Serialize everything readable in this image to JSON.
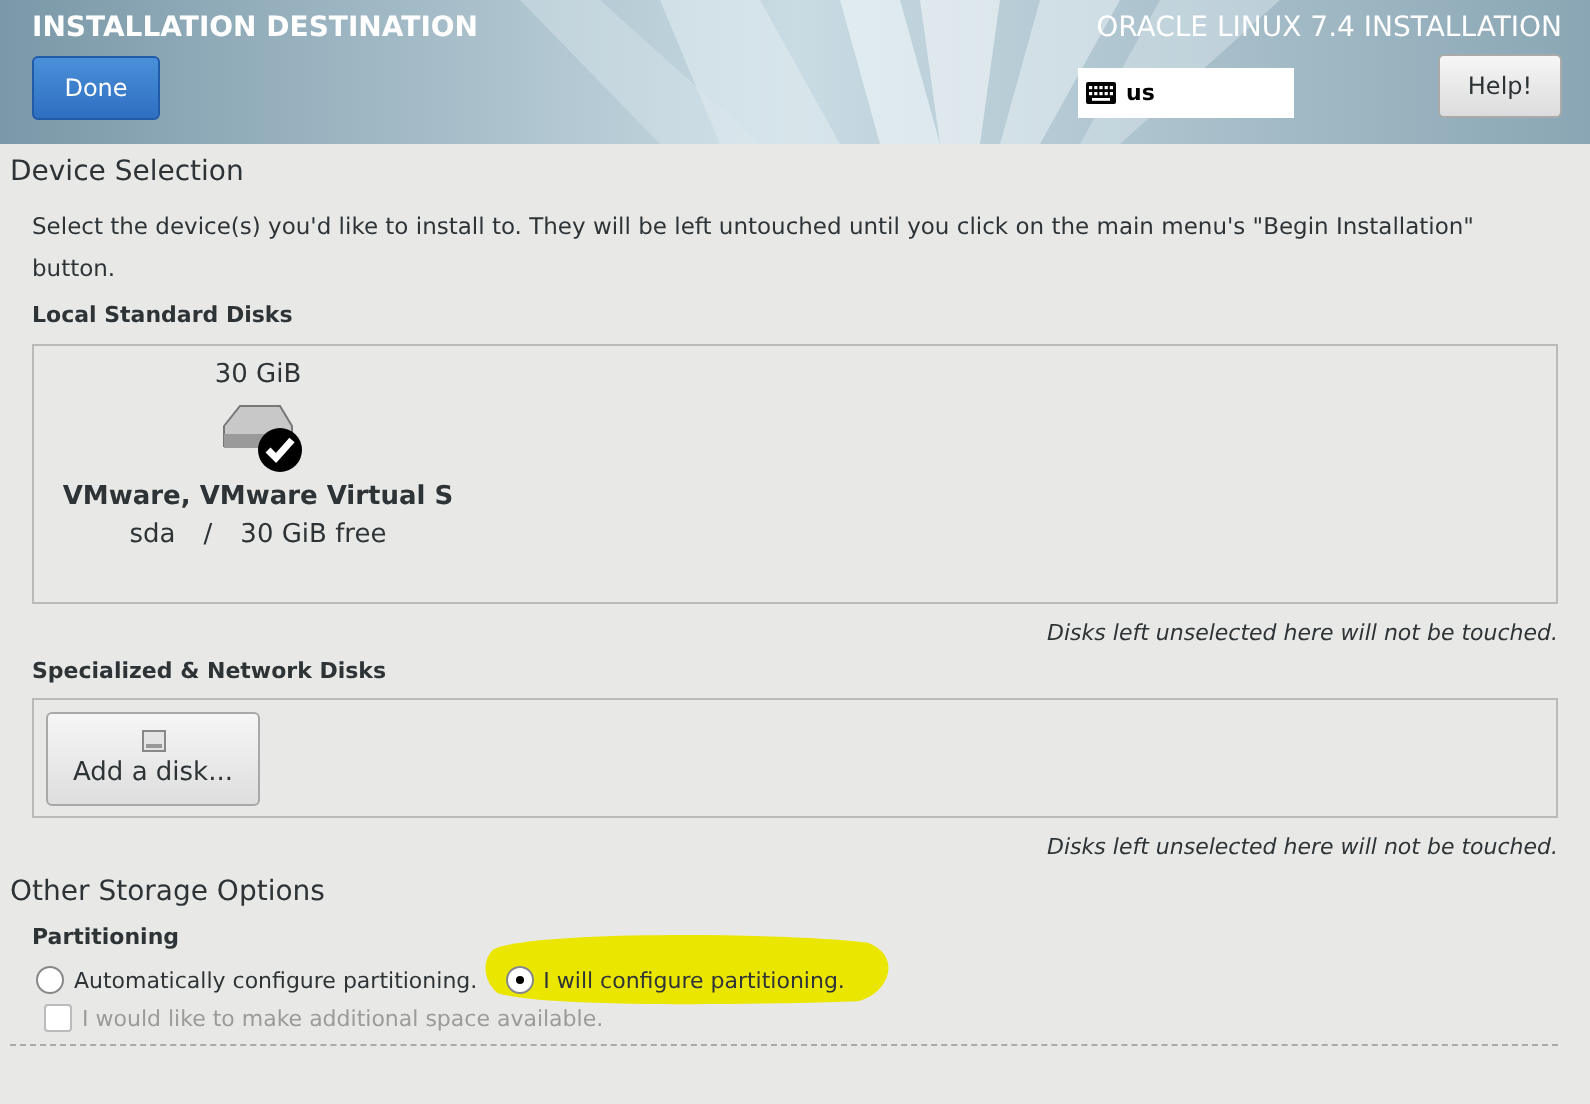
{
  "header": {
    "title": "INSTALLATION DESTINATION",
    "product": "ORACLE LINUX 7.4 INSTALLATION",
    "done_button": "Done",
    "keyboard_layout": "us",
    "help_button": "Help!"
  },
  "device_selection": {
    "heading": "Device Selection",
    "intro": "Select the device(s) you'd like to install to.  They will be left untouched until you click on the main menu's \"Begin Installation\" button.",
    "local_disks": {
      "label": "Local Standard Disks",
      "disks": [
        {
          "size": "30 GiB",
          "name": "VMware, VMware Virtual S",
          "device": "sda",
          "separator": "/",
          "free": "30 GiB free",
          "selected": true
        }
      ],
      "note": "Disks left unselected here will not be touched."
    },
    "network_disks": {
      "label": "Specialized & Network Disks",
      "add_button": "Add a disk...",
      "note": "Disks left unselected here will not be touched."
    }
  },
  "other_storage": {
    "heading": "Other Storage Options",
    "partitioning_label": "Partitioning",
    "options": [
      {
        "label": "Automatically configure partitioning.",
        "selected": false,
        "highlighted": false
      },
      {
        "label": "I will configure partitioning.",
        "selected": true,
        "highlighted": true
      }
    ],
    "extra_space": {
      "label": "I would like to make additional space available.",
      "checked": false,
      "disabled": true
    }
  }
}
